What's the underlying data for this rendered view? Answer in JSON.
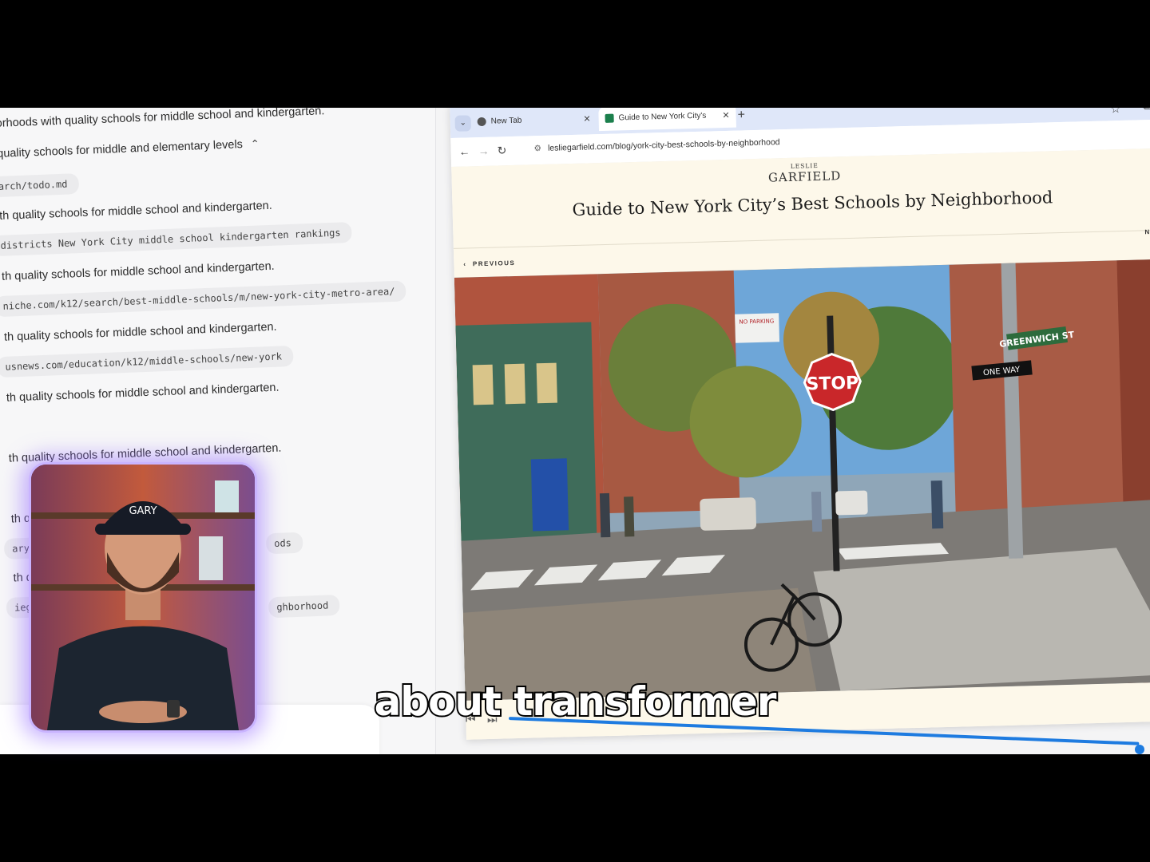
{
  "chat": {
    "lines": [
      "orhoods with quality schools for middle school and kindergarten.",
      "quality schools for middle and elementary levels",
      "th quality schools for middle school and kindergarten.",
      "th quality schools for middle school and kindergarten.",
      "th quality schools for middle school and kindergarten.",
      "th quality schools for middle school and kindergarten.",
      "th quality schools for middle school and kindergarten.",
      "th qua",
      "th qua"
    ],
    "chips": [
      "arch/todo.md",
      "districts New York City middle school kindergarten rankings",
      "niche.com/k12/search/best-middle-schools/m/new-york-city-metro-area/",
      "usnews.com/education/k12/middle-schools/new-york",
      "ary s",
      "iegarf"
    ],
    "chip_fragments": [
      "ods",
      "ghborhood"
    ],
    "top_url_fragment": "https://lesliegarfield.com/..."
  },
  "browser": {
    "tabs": [
      {
        "label": "New Tab",
        "active": false
      },
      {
        "label": "Guide to New York City's",
        "active": true
      }
    ],
    "url": "lesliegarfield.com/blog/york-city-best-schools-by-neighborhood"
  },
  "article": {
    "brand_top": "LESLIE",
    "brand_bottom": "GARFIELD",
    "title": "Guide to New York City’s Best Schools by Neighborhood",
    "prev_label": "PREVIOUS",
    "next_label": "NE",
    "street_signs": {
      "stop": "STOP",
      "street": "GREENWICH ST",
      "one_way": "ONE WAY",
      "no_parking": "NO PARKING"
    }
  },
  "webcam": {
    "cap_text": "GARY"
  },
  "caption": "about transformer",
  "colors": {
    "accent_blue": "#1e7be0",
    "webcam_glow": "#c9b4ff",
    "page_bg": "#fdf8ea"
  }
}
